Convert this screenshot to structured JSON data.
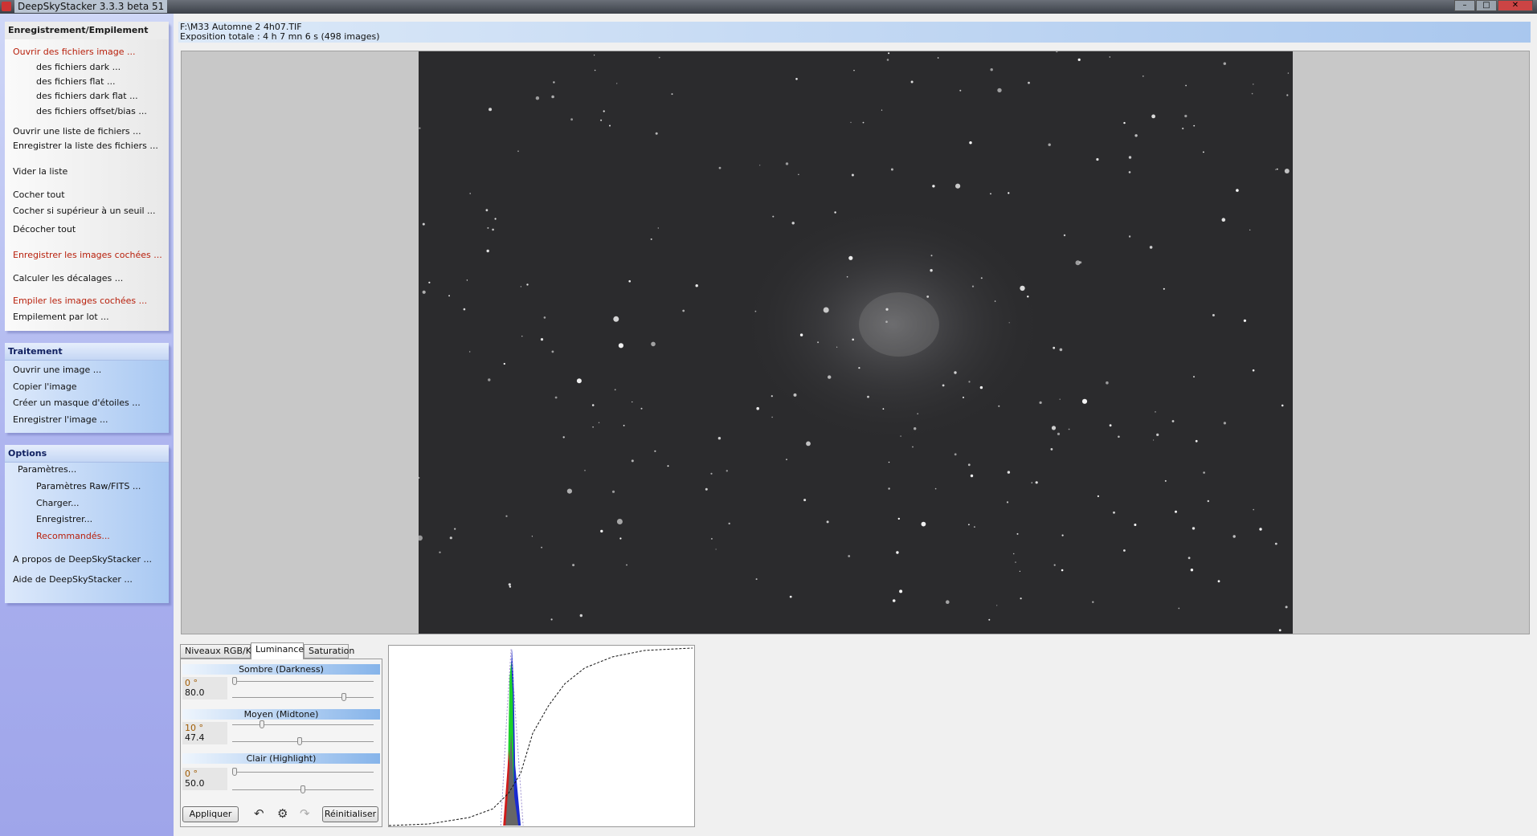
{
  "window": {
    "title": "DeepSkyStacker 3.3.3 beta 51"
  },
  "sidebar": {
    "registering": {
      "title": "Enregistrement/Empilement",
      "items": [
        {
          "label": "Ouvrir des fichiers image ...",
          "highlight": true
        },
        {
          "label": "des fichiers dark ..."
        },
        {
          "label": "des fichiers flat ..."
        },
        {
          "label": "des fichiers dark flat ..."
        },
        {
          "label": "des fichiers offset/bias ..."
        },
        {
          "label": "Ouvrir une liste de fichiers ..."
        },
        {
          "label": "Enregistrer la liste des fichiers ..."
        },
        {
          "label": "Vider la liste"
        },
        {
          "label": "Cocher tout"
        },
        {
          "label": "Cocher si supérieur à un seuil ..."
        },
        {
          "label": "Décocher tout"
        },
        {
          "label": "Enregistrer les images cochées ...",
          "highlight": true
        },
        {
          "label": "Calculer les décalages ..."
        },
        {
          "label": "Empiler les images cochées ...",
          "highlight": true
        },
        {
          "label": "Empilement par lot ..."
        }
      ]
    },
    "processing": {
      "title": "Traitement",
      "items": [
        {
          "label": "Ouvrir une image ..."
        },
        {
          "label": "Copier l'image"
        },
        {
          "label": "Créer un masque d'étoiles ..."
        },
        {
          "label": "Enregistrer l'image ..."
        }
      ]
    },
    "options": {
      "title": "Options",
      "items": [
        {
          "label": "Paramètres..."
        },
        {
          "label": "Paramètres Raw/FITS ..."
        },
        {
          "label": "Charger..."
        },
        {
          "label": "Enregistrer..."
        },
        {
          "label": "Recommandés...",
          "highlight": true
        },
        {
          "label": "A propos de DeepSkyStacker ..."
        },
        {
          "label": "Aide de DeepSkyStacker ..."
        }
      ]
    }
  },
  "info": {
    "file": "F:\\M33 Automne 2 4h07.TIF",
    "exposure": "Exposition totale : 4 h 7 mn 6 s (498 images)"
  },
  "tabs": [
    {
      "label": "Niveaux RGB/K"
    },
    {
      "label": "Luminance",
      "active": true
    },
    {
      "label": "Saturation"
    }
  ],
  "luminance": {
    "darkness": {
      "title": "Sombre (Darkness)",
      "angle": "0 °",
      "value": "80.0",
      "angle_pos": 0.0,
      "value_pos": 0.8
    },
    "midtone": {
      "title": "Moyen (Midtone)",
      "angle": "10 °",
      "value": "47.4",
      "angle_pos": 0.2,
      "value_pos": 0.474
    },
    "highlight": {
      "title": "Clair (Highlight)",
      "angle": "0 °",
      "value": "50.0",
      "angle_pos": 0.0,
      "value_pos": 0.5
    }
  },
  "buttons": {
    "apply": "Appliquer",
    "reset": "Réinitialiser"
  },
  "colors": {
    "red_link": "#b8200c",
    "accent": "#86b4ea"
  }
}
